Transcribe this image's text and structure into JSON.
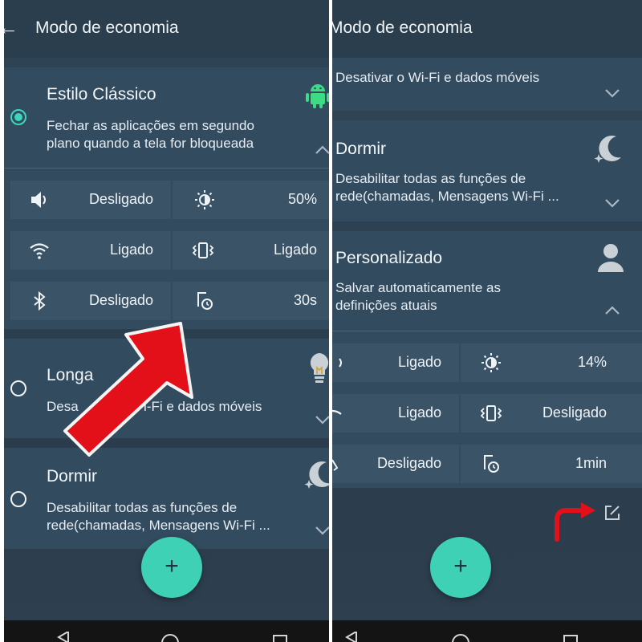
{
  "left": {
    "header": {
      "title": "Modo de economia",
      "back_icon": "arrow-back-icon"
    },
    "classic": {
      "title": "Estilo Clássico",
      "desc": "Fechar as aplicações em segundo plano quando a tela for bloqueada",
      "settings": [
        {
          "icon": "volume-icon",
          "value": "Desligado"
        },
        {
          "icon": "brightness-icon",
          "value": "50%"
        },
        {
          "icon": "wifi-icon",
          "value": "Ligado"
        },
        {
          "icon": "vibrate-icon",
          "value": "Ligado"
        },
        {
          "icon": "bluetooth-icon",
          "value": "Desligado"
        },
        {
          "icon": "screen-timeout-icon",
          "value": "30s"
        }
      ]
    },
    "longa": {
      "title": "Longa",
      "desc": "Desa",
      "desc_tail": "i-Fi e dados móveis"
    },
    "dormir": {
      "title": "Dormir",
      "desc": "Desabilitar todas as funções de rede(chamadas, Mensagens Wi-Fi ..."
    },
    "fab_label": "+"
  },
  "right": {
    "header": {
      "title": "Modo de economia"
    },
    "wifi_card": {
      "desc": "Desativar o Wi-Fi e dados móveis"
    },
    "dormir": {
      "title": "Dormir",
      "desc": "Desabilitar todas as funções de rede(chamadas, Mensagens Wi-Fi ..."
    },
    "personalizado": {
      "title": "Personalizado",
      "desc": "Salvar automaticamente as definições atuais",
      "settings": [
        {
          "icon": "volume-icon",
          "value": "Ligado"
        },
        {
          "icon": "brightness-icon",
          "value": "14%"
        },
        {
          "icon": "wifi-icon",
          "value": "Ligado"
        },
        {
          "icon": "vibrate-icon",
          "value": "Desligado"
        },
        {
          "icon": "bluetooth-icon",
          "value": "Desligado"
        },
        {
          "icon": "screen-timeout-icon",
          "value": "1min"
        }
      ]
    },
    "fab_label": "+"
  },
  "colors": {
    "accent": "#3ed1b5",
    "card": "#324b5e",
    "cell": "#3a5367",
    "annotation": "#e3101a"
  }
}
